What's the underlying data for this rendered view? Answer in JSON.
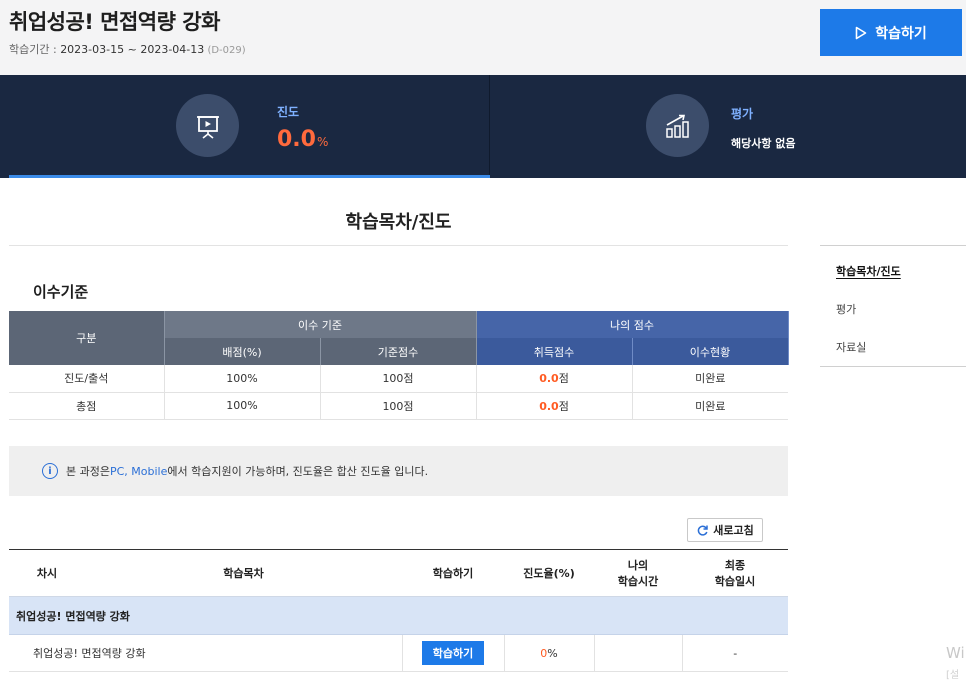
{
  "header": {
    "course_title": "취업성공! 면접역량 강화",
    "period_label": "학습기간 : ",
    "period_range": "2023-03-15 ~ 2023-04-13",
    "period_dday": " (D-029)",
    "study_button": "학습하기"
  },
  "dashboard": {
    "progress_label": "진도",
    "progress_value": "0.0",
    "progress_unit": "%",
    "eval_label": "평가",
    "eval_text": "해당사항 없음"
  },
  "section": {
    "title": "학습목차/진도"
  },
  "criteria": {
    "title": "이수기준",
    "head": {
      "category": "구분",
      "criteria_group": "이수 기준",
      "my_group": "나의 점수",
      "weight": "배점(%)",
      "base_score": "기준점수",
      "earned": "취득점수",
      "status": "이수현황"
    },
    "rows": [
      {
        "category": "진도/출석",
        "weight": "100%",
        "base": "100점",
        "earned": "0.0",
        "earned_unit": "점",
        "status": "미완료"
      },
      {
        "category": "총점",
        "weight": "100%",
        "base": "100점",
        "earned": "0.0",
        "earned_unit": "점",
        "status": "미완료"
      }
    ]
  },
  "notice": {
    "pre": "본 과정은 ",
    "devices": "PC, Mobile",
    "post": " 에서 학습지원이 가능하며, 진도율은 합산 진도율 입니다."
  },
  "refresh_label": "새로고침",
  "progress_table": {
    "head": {
      "seq": "차시",
      "toc": "학습목차",
      "study": "학습하기",
      "rate": "진도율(%)",
      "my_time_1": "나의",
      "my_time_2": "학습시간",
      "last_1": "최종",
      "last_2": "학습일시"
    },
    "group": "취업성공! 면접역량 강화",
    "items": [
      {
        "name": "취업성공! 면접역량 강화",
        "button": "학습하기",
        "rate": "0",
        "rate_unit": "%",
        "time": "",
        "last": "-"
      }
    ]
  },
  "side_nav": {
    "items": [
      "학습목차/진도",
      "평가",
      "자료실"
    ]
  },
  "watermark": {
    "line1": "Wi",
    "line2": "[설"
  }
}
